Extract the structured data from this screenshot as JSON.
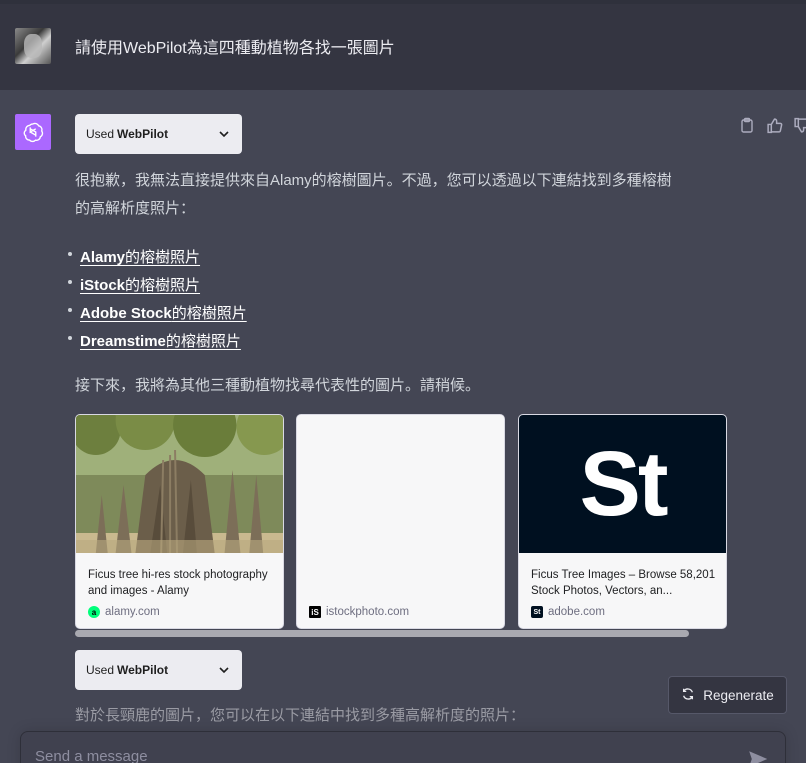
{
  "user_message": {
    "text": "請使用WebPilot為這四種動植物各找一張圖片"
  },
  "plugin_pills": [
    {
      "prefix": "Used",
      "name": "WebPilot"
    },
    {
      "prefix": "Used",
      "name": "WebPilot"
    }
  ],
  "assistant": {
    "intro_line1": "很抱歉，我無法直接提供來自Alamy的榕樹圖片。不過，您可以透過以下連結找到多種榕樹",
    "intro_line2": "的高解析度照片：",
    "links": [
      {
        "bold": "Alamy",
        "rest": "的榕樹照片"
      },
      {
        "bold": "iStock",
        "rest": "的榕樹照片"
      },
      {
        "bold": "Adobe Stock",
        "rest": "的榕樹照片"
      },
      {
        "bold": "Dreamstime",
        "rest": "的榕樹照片"
      }
    ],
    "follow_up": "接下來，我將為其他三種動植物找尋代表性的圖片。請稍候。",
    "next_text": "對於長頸鹿的圖片，您可以在以下連結中找到多種高解析度的照片："
  },
  "cards": [
    {
      "title": "Ficus tree hi-res stock photography and images - Alamy",
      "source": "alamy.com",
      "favicon": "a"
    },
    {
      "title": "",
      "source": "istockphoto.com",
      "favicon": "iS"
    },
    {
      "title": "Ficus Tree Images – Browse 58,201 Stock Photos, Vectors, an...",
      "source": "adobe.com",
      "favicon": "St"
    }
  ],
  "adobe_logo_text": "St",
  "regenerate_label": "Regenerate",
  "composer": {
    "placeholder": "Send a message"
  },
  "colors": {
    "background": "#444654",
    "user_row": "#343541",
    "gpt_avatar": "#ab68ff",
    "link": "#ffffff",
    "card_bg": "#f7f7f8",
    "adobe_tile": "#001020",
    "alamy_favicon": "#00ff7b"
  }
}
